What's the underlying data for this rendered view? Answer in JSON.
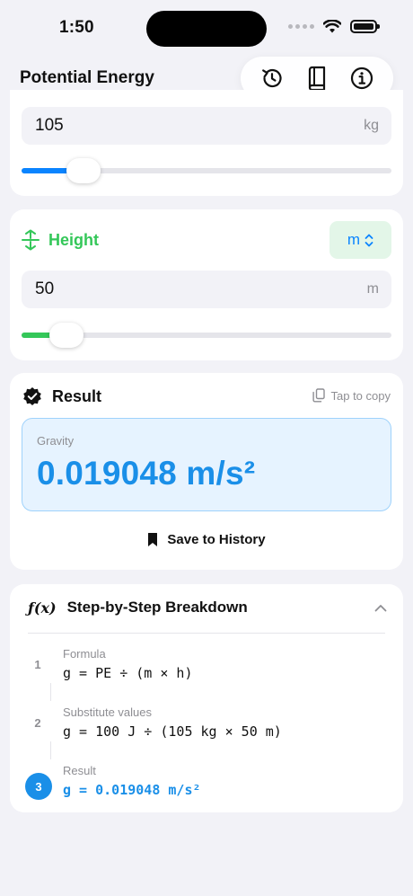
{
  "status_bar": {
    "time": "1:50"
  },
  "header": {
    "title": "Potential Energy"
  },
  "mass": {
    "value": "105",
    "unit": "kg",
    "slider_fraction": 0.14
  },
  "height": {
    "label": "Height",
    "unit_select": "m",
    "value": "50",
    "unit": "m",
    "slider_fraction": 0.09,
    "accent": "#34c759"
  },
  "result": {
    "title": "Result",
    "copy_hint": "Tap to copy",
    "label": "Gravity",
    "value": "0.019048 m/s²",
    "save_label": "Save to History",
    "accent": "#1a8fe8"
  },
  "breakdown": {
    "icon_text": "ƒ(x)",
    "title": "Step-by-Step Breakdown",
    "steps": [
      {
        "number": "1",
        "label": "Formula",
        "formula": "g = PE ÷ (m × h)"
      },
      {
        "number": "2",
        "label": "Substitute values",
        "formula": "g = 100 J ÷ (105 kg × 50 m)"
      },
      {
        "number": "3",
        "label": "Result",
        "formula": "g = 0.019048 m/s²"
      }
    ]
  }
}
